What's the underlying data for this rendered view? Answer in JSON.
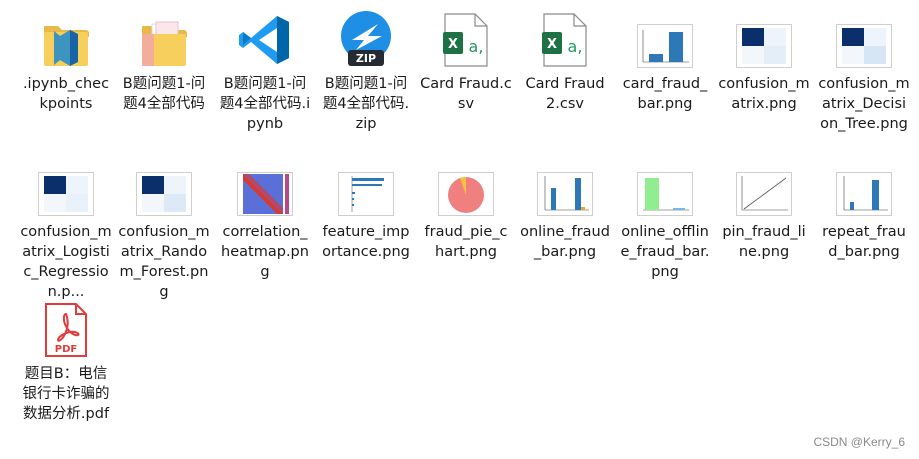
{
  "files": [
    {
      "name": ".ipynb_checkpoints",
      "icon": "folder-vscode-icon"
    },
    {
      "name": "B题问题1-问题4全部代码",
      "icon": "folder-docs-icon"
    },
    {
      "name": "B题问题1-问题4全部代码.ipynb",
      "icon": "vscode-icon"
    },
    {
      "name": "B题问题1-问题4全部代码.zip",
      "icon": "zip-icon"
    },
    {
      "name": "Card Fraud.csv",
      "icon": "excel-csv-icon"
    },
    {
      "name": "Card Fraud2.csv",
      "icon": "excel-csv-icon"
    },
    {
      "name": "card_fraud_bar.png",
      "icon": "bar-chart-thumbnail-icon"
    },
    {
      "name": "confusion_matrix.png",
      "icon": "confusion-matrix-thumbnail-icon"
    },
    {
      "name": "confusion_matrix_Decision_Tree.png",
      "icon": "confusion-matrix-thumbnail-icon"
    },
    {
      "name": "confusion_matrix_Logistic_Regression.p...",
      "icon": "confusion-matrix-thumbnail-icon"
    },
    {
      "name": "confusion_matrix_Random_Forest.png",
      "icon": "confusion-matrix-thumbnail-icon"
    },
    {
      "name": "correlation_heatmap.png",
      "icon": "heatmap-thumbnail-icon"
    },
    {
      "name": "feature_importance.png",
      "icon": "feature-importance-thumbnail-icon"
    },
    {
      "name": "fraud_pie_chart.png",
      "icon": "pie-chart-thumbnail-icon"
    },
    {
      "name": "online_fraud_bar.png",
      "icon": "bar-chart-thumbnail-icon"
    },
    {
      "name": "online_offline_fraud_bar.png",
      "icon": "green-bar-thumbnail-icon"
    },
    {
      "name": "pin_fraud_line.png",
      "icon": "line-chart-thumbnail-icon"
    },
    {
      "name": "repeat_fraud_bar.png",
      "icon": "bar-chart-thumbnail-icon"
    },
    {
      "name": "题目B：电信银行卡诈骗的数据分析.pdf",
      "icon": "pdf-icon"
    }
  ],
  "watermark": "CSDN @Kerry_6",
  "colors": {
    "accent": "#2b88d8",
    "excel": "#1e7145",
    "pdf": "#e23b3b",
    "text": "#1a1a1a"
  }
}
